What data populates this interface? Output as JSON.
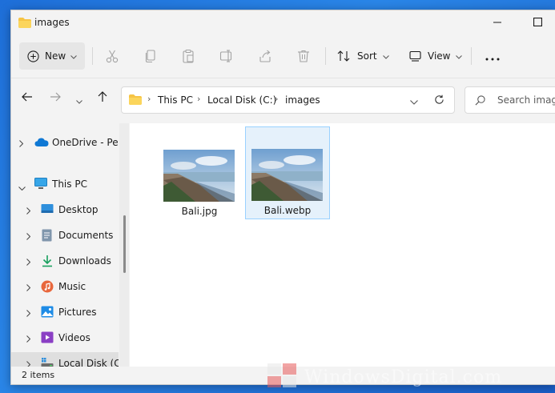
{
  "window": {
    "title": "images"
  },
  "toolbar": {
    "new_label": "New",
    "sort_label": "Sort",
    "view_label": "View",
    "icons": [
      "cut-icon",
      "copy-icon",
      "paste-icon",
      "rename-icon",
      "share-icon",
      "delete-icon"
    ]
  },
  "address": {
    "crumbs": [
      "This PC",
      "Local Disk (C:)",
      "images"
    ],
    "search_placeholder": "Search images"
  },
  "nav": {
    "items": [
      {
        "label": "OneDrive - Pers",
        "icon": "onedrive-icon"
      },
      {
        "label": "This PC",
        "icon": "pc-icon"
      },
      {
        "label": "Desktop",
        "icon": "desktop-icon"
      },
      {
        "label": "Documents",
        "icon": "documents-icon"
      },
      {
        "label": "Downloads",
        "icon": "downloads-icon"
      },
      {
        "label": "Music",
        "icon": "music-icon"
      },
      {
        "label": "Pictures",
        "icon": "pictures-icon"
      },
      {
        "label": "Videos",
        "icon": "videos-icon"
      },
      {
        "label": "Local Disk (C:)",
        "icon": "drive-icon"
      }
    ]
  },
  "files": [
    {
      "name": "Bali.jpg",
      "selected": false
    },
    {
      "name": "Bali.webp",
      "selected": true
    }
  ],
  "status": {
    "count": "2 items"
  },
  "watermark": {
    "text": "WindowsDigital.com"
  },
  "colors": {
    "accent": "#0067c0",
    "folder": "#f6c445",
    "selection": "#e5f1fb",
    "selection_border": "#99d1ff"
  }
}
